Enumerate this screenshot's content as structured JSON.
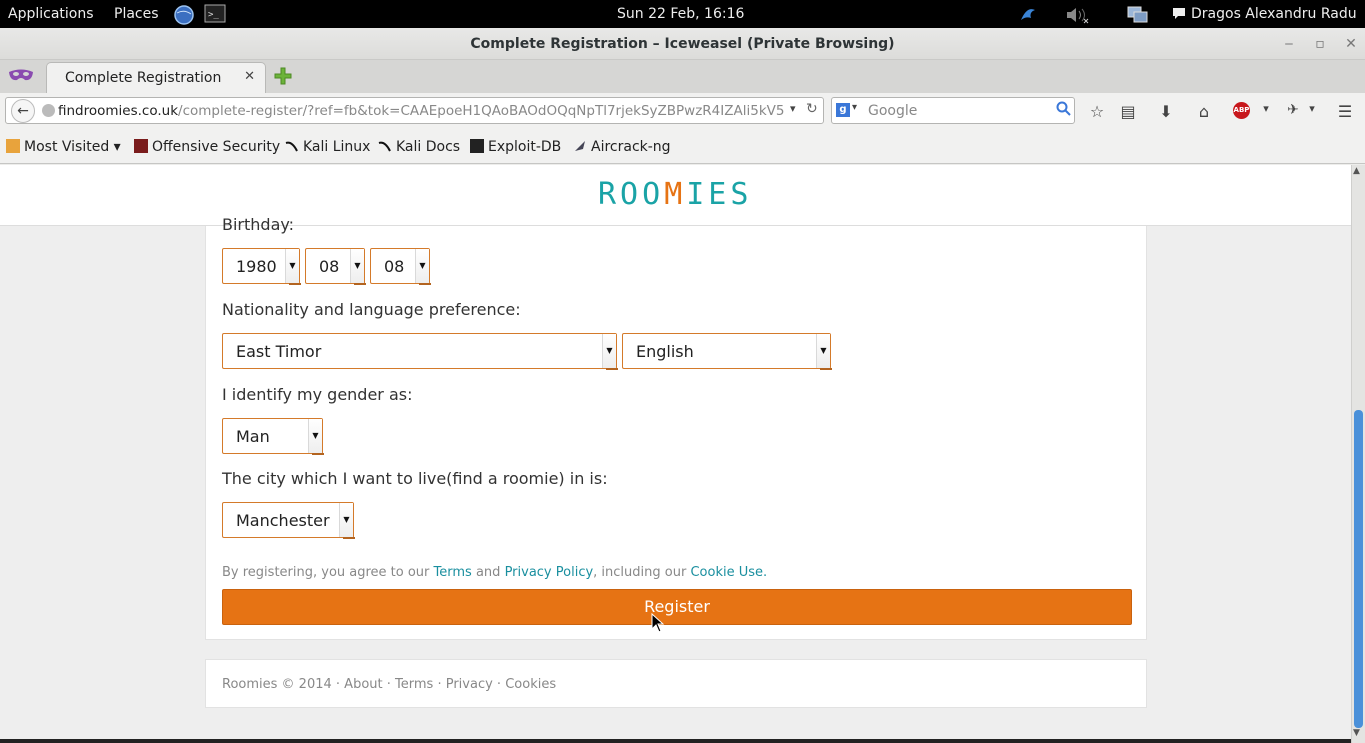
{
  "panel": {
    "applications": "Applications",
    "places": "Places",
    "clock": "Sun 22 Feb, 16:16",
    "user": "Dragos Alexandru Radu"
  },
  "window": {
    "title": "Complete Registration – Iceweasel (Private Browsing)"
  },
  "tabs": [
    {
      "label": "Complete Registration",
      "close": "✕"
    }
  ],
  "navbar": {
    "url_domain": "findroomies.co.uk",
    "url_rest": "/complete-register/?ref=fb&tok=CAAEpoeH1QAoBAOdOQqNpTl7rjekSyZBPwzR4IZAli5kV5",
    "search_placeholder": "Google"
  },
  "bookmarks": [
    {
      "label": "Most Visited",
      "icon": "folder-icon"
    },
    {
      "label": "Offensive Security",
      "icon": "offsec-icon"
    },
    {
      "label": "Kali Linux",
      "icon": "kali-icon"
    },
    {
      "label": "Kali Docs",
      "icon": "kali-icon"
    },
    {
      "label": "Exploit-DB",
      "icon": "exploitdb-icon"
    },
    {
      "label": "Aircrack-ng",
      "icon": "aircrack-icon"
    }
  ],
  "site": {
    "logo_left": "ROO",
    "logo_mid": "M",
    "logo_right": "IES",
    "colors": {
      "accent": "#e67314",
      "teal": "#1aa3a6"
    }
  },
  "form": {
    "birthday_label": "Birthday:",
    "year": "1980",
    "month": "08",
    "day": "08",
    "nationality_label": "Nationality and language preference:",
    "nationality": "East Timor",
    "language": "English",
    "gender_label": "I identify my gender as:",
    "gender": "Man",
    "city_label": "The city which I want to live(find a roomie) in is:",
    "city": "Manchester",
    "terms_prefix": "By registering, you agree to our ",
    "terms_link": "Terms",
    "terms_and": " and ",
    "privacy_link": "Privacy Policy",
    "terms_mid": ", including our ",
    "cookie_link": "Cookie Use",
    "terms_end": ".",
    "register_button": "Register"
  },
  "footer": {
    "copyright": "Roomies © 2014",
    "sep": " · ",
    "about": "About",
    "terms": "Terms",
    "privacy": "Privacy",
    "cookies": "Cookies"
  }
}
